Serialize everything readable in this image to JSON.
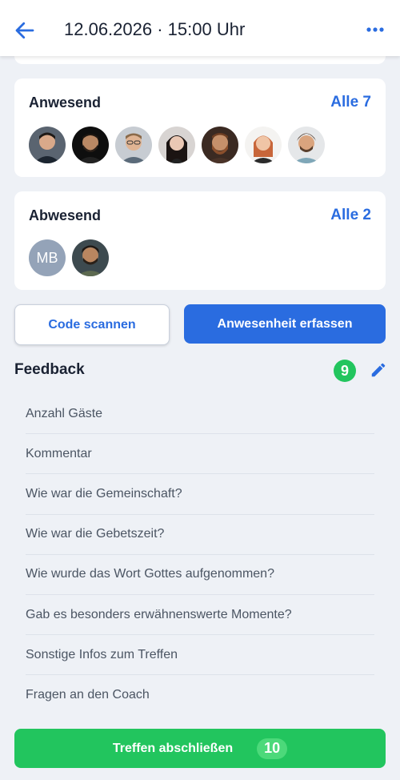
{
  "header": {
    "title": "12.06.2026 · 15:00 Uhr",
    "back_icon": "arrow-left-icon",
    "menu_icon": "more-horizontal-icon"
  },
  "present": {
    "title": "Anwesend",
    "link": "Alle 7",
    "avatars": [
      {
        "type": "photo",
        "desc": "man dark hair"
      },
      {
        "type": "photo",
        "desc": "man bearded dark background"
      },
      {
        "type": "photo",
        "desc": "man with glasses"
      },
      {
        "type": "photo",
        "desc": "woman dark hair"
      },
      {
        "type": "photo",
        "desc": "man with beard"
      },
      {
        "type": "photo",
        "desc": "woman red hair"
      },
      {
        "type": "photo",
        "desc": "man curly hair"
      }
    ]
  },
  "absent": {
    "title": "Abwesend",
    "link": "Alle 2",
    "avatar_initials": "MB"
  },
  "actions": {
    "scan_label": "Code scannen",
    "record_label": "Anwesenheit erfassen"
  },
  "feedback": {
    "title": "Feedback",
    "count": "9",
    "items": [
      "Anzahl Gäste",
      "Kommentar",
      "Wie war die Gemeinschaft?",
      "Wie war die Gebetszeit?",
      "Wie wurde das Wort Gottes aufgenommen?",
      "Gab es besonders erwähnenswerte Momente?",
      "Sonstige Infos zum Treffen",
      "Fragen an den Coach"
    ]
  },
  "finish": {
    "label": "Treffen abschließen",
    "count": "10"
  },
  "colors": {
    "accent": "#2a6ce0",
    "success": "#22c55e",
    "background": "#eef1f6"
  }
}
